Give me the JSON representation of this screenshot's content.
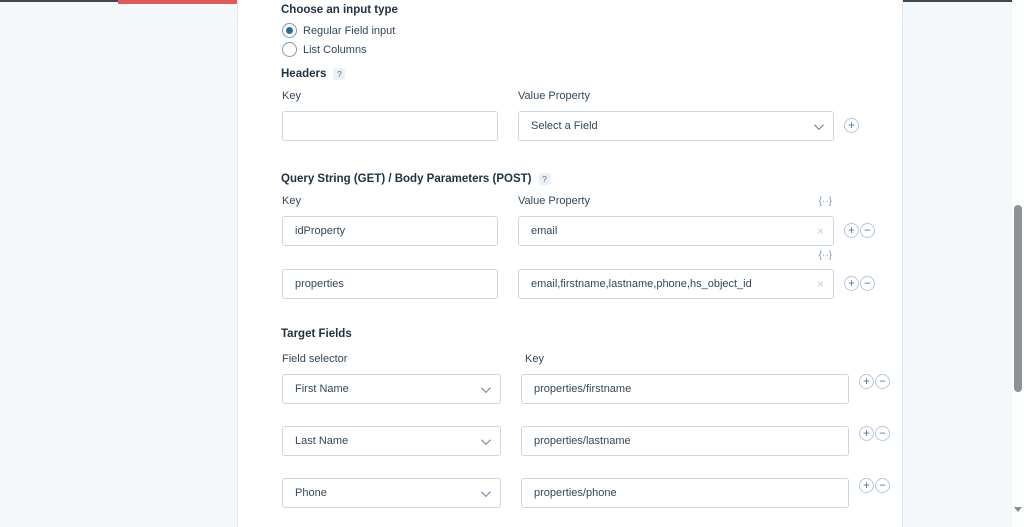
{
  "colors": {
    "accent_red": "#e2595c"
  },
  "input_type": {
    "heading": "Choose an input type",
    "options": [
      {
        "label": "Regular Field input",
        "selected": true
      },
      {
        "label": "List Columns",
        "selected": false
      }
    ]
  },
  "headers": {
    "heading": "Headers",
    "key_label": "Key",
    "value_label": "Value Property",
    "key_value": "",
    "value_selected": "Select a Field"
  },
  "query": {
    "heading": "Query String (GET) / Body Parameters (POST)",
    "key_label": "Key",
    "value_label": "Value Property",
    "rows": [
      {
        "key": "idProperty",
        "value": "email"
      },
      {
        "key": "properties",
        "value": "email,firstname,lastname,phone,hs_object_id"
      }
    ]
  },
  "targets": {
    "heading": "Target Fields",
    "selector_label": "Field selector",
    "key_label": "Key",
    "rows": [
      {
        "field": "First Name",
        "key": "properties/firstname"
      },
      {
        "field": "Last Name",
        "key": "properties/lastname"
      },
      {
        "field": "Phone",
        "key": "properties/phone"
      }
    ]
  },
  "icons": {
    "help": "?",
    "add": "+",
    "remove": "−",
    "clear": "×",
    "merge_tag": "{··}"
  }
}
